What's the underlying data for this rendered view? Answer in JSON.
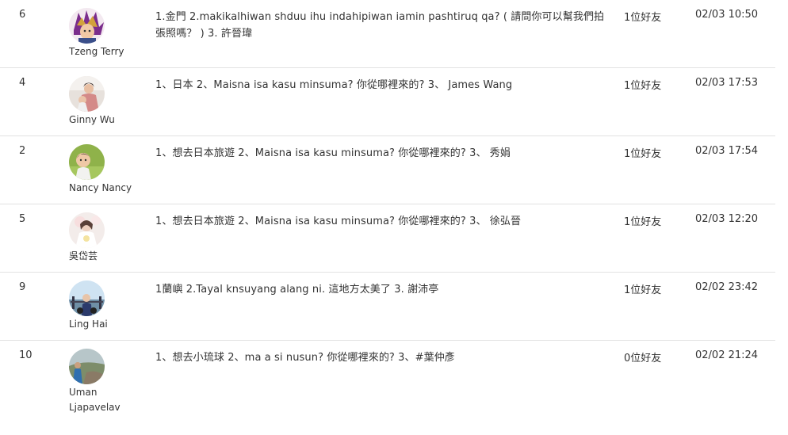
{
  "rows": [
    {
      "num": "6",
      "avatar_icon": "cartoon-character-avatar-icon",
      "name": "Tzeng Terry",
      "message": "1.金門 2.makikalhiwan shduu ihu indahipiwan iamin pashtiruq qa? ( 請問你可以幫我們拍張照嗎？ ) 3. 許晉瑋",
      "friends": "1位好友",
      "time": "02/03 10:50"
    },
    {
      "num": "4",
      "avatar_icon": "person-photo-avatar-icon",
      "name": "Ginny Wu",
      "message": "1、日本 2、Maisna isa kasu minsuma? 你從哪裡來的? 3、 James Wang",
      "friends": "1位好友",
      "time": "02/03 17:53"
    },
    {
      "num": "2",
      "avatar_icon": "child-photo-avatar-icon",
      "name": "Nancy Nancy",
      "message": "1、想去日本旅遊 2、Maisna isa kasu minsuma? 你從哪裡來的? 3、 秀娟",
      "friends": "1位好友",
      "time": "02/03 17:54"
    },
    {
      "num": "5",
      "avatar_icon": "bride-photo-avatar-icon",
      "name": "吳岱芸",
      "message": "1、想去日本旅遊 2、Maisna isa kasu minsuma? 你從哪裡來的? 3、 徐弘晉",
      "friends": "1位好友",
      "time": "02/03 12:20"
    },
    {
      "num": "9",
      "avatar_icon": "outdoor-photo-avatar-icon",
      "name": "Ling Hai",
      "message": "1蘭嶼 2.Tayal knsuyang alang ni. 這地方太美了 3. 謝沛亭",
      "friends": "1位好友",
      "time": "02/02 23:42"
    },
    {
      "num": "10",
      "avatar_icon": "landscape-photo-avatar-icon",
      "name": "Uman Ljapavelav",
      "message": "1、想去小琉球 2、ma a si nusun? 你從哪裡來的? 3、#葉仲彥",
      "friends": "0位好友",
      "time": "02/02 21:24"
    }
  ]
}
